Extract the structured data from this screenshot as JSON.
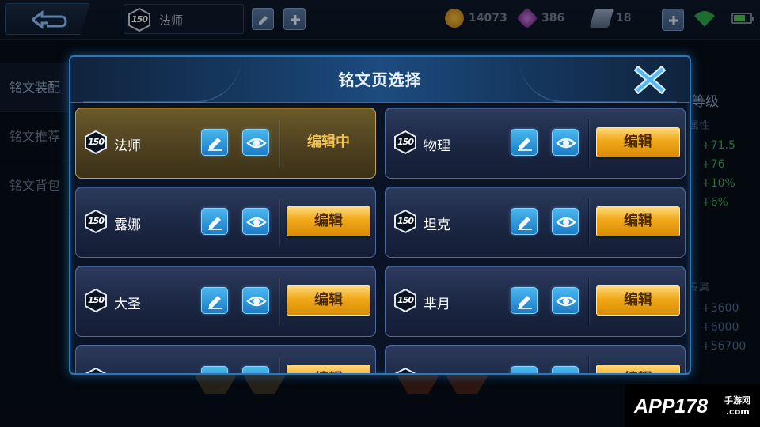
{
  "topbar": {
    "page_name": "法师",
    "page_level": "150",
    "gold": "14073",
    "diamond": "386",
    "voucher": "18"
  },
  "left_nav": {
    "items": [
      {
        "label": "铭文装配"
      },
      {
        "label": "铭文推荐"
      },
      {
        "label": "铭文背包"
      }
    ]
  },
  "right_panel": {
    "title": "等级",
    "attr_label": "属性",
    "attr_values": [
      "+71.5",
      "+76",
      "+10%",
      "+6%"
    ],
    "exclusive_label": "专属",
    "exclusive_values": [
      "+3600",
      "+6000",
      "+56700"
    ]
  },
  "modal": {
    "title": "铭文页选择",
    "edit_label": "编辑",
    "editing_label": "编辑中",
    "pages": [
      {
        "level": "150",
        "name": "法师",
        "editing": true
      },
      {
        "level": "150",
        "name": "物理",
        "editing": false
      },
      {
        "level": "150",
        "name": "露娜",
        "editing": false
      },
      {
        "level": "150",
        "name": "坦克",
        "editing": false
      },
      {
        "level": "150",
        "name": "大圣",
        "editing": false
      },
      {
        "level": "150",
        "name": "芈月",
        "editing": false
      }
    ]
  },
  "watermark": {
    "brand": "APP178",
    "sub1": "手游网",
    "sub2": ".com"
  },
  "colors": {
    "accent_blue": "#2a78b8",
    "edit_button": "#f0a818",
    "active_card": "#6c5a2a",
    "positive_stat": "#3da85a"
  }
}
